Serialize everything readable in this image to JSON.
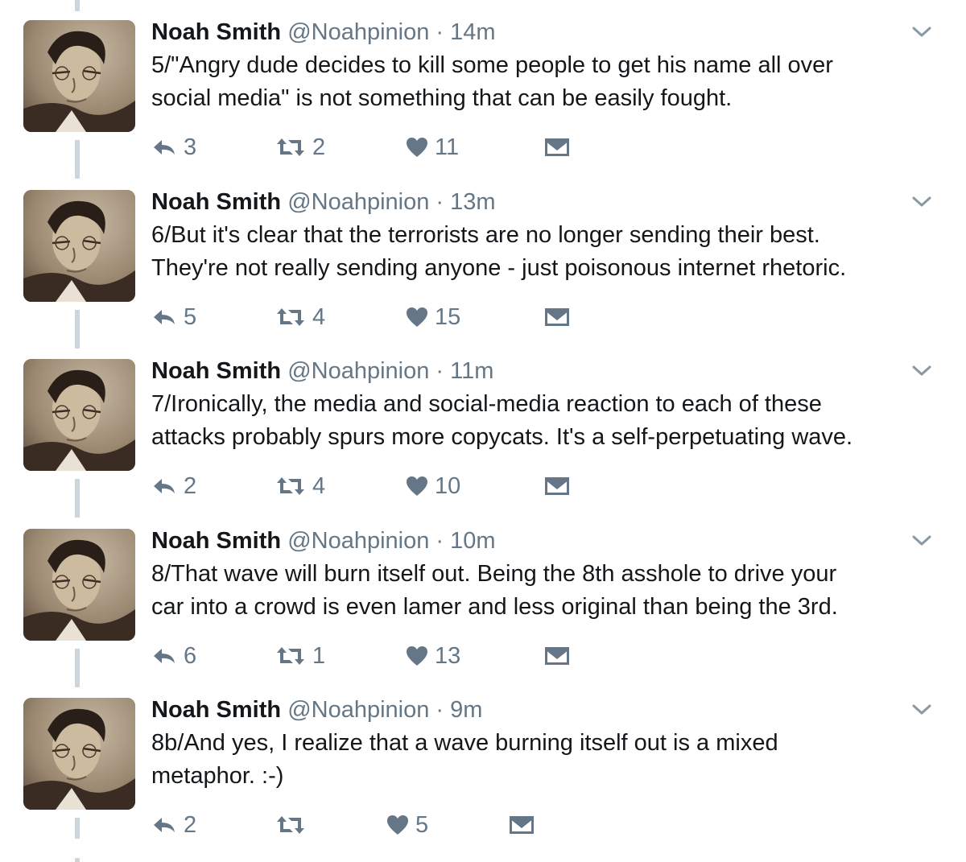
{
  "colors": {
    "name": "#14171a",
    "secondary": "#657786",
    "thread_line": "#ccd6dd"
  },
  "icons": {
    "reply": "reply-icon",
    "retweet": "retweet-icon",
    "like": "heart-icon",
    "dm": "envelope-icon",
    "more": "chevron-down-icon"
  },
  "tweets": [
    {
      "name": "Noah Smith",
      "handle": "@Noahpinion",
      "dot": "·",
      "time": "14m",
      "text": "5/\"Angry dude decides to kill some people to get his name all over\nsocial media\" is not something that can be easily fought.",
      "replies": "3",
      "retweets": "2",
      "likes": "11"
    },
    {
      "name": "Noah Smith",
      "handle": "@Noahpinion",
      "dot": "·",
      "time": "13m",
      "text": "6/But it's clear that the terrorists are no longer sending their best.\nThey're not really sending anyone - just poisonous internet rhetoric.",
      "replies": "5",
      "retweets": "4",
      "likes": "15"
    },
    {
      "name": "Noah Smith",
      "handle": "@Noahpinion",
      "dot": "·",
      "time": "11m",
      "text": "7/Ironically, the media and social-media reaction to each of these\nattacks probably spurs more copycats. It's a self-perpetuating wave.",
      "replies": "2",
      "retweets": "4",
      "likes": "10"
    },
    {
      "name": "Noah Smith",
      "handle": "@Noahpinion",
      "dot": "·",
      "time": "10m",
      "text": "8/That wave will burn itself out. Being the 8th asshole to drive your\ncar into a crowd is even lamer and less original than being the 3rd.",
      "replies": "6",
      "retweets": "1",
      "likes": "13"
    },
    {
      "name": "Noah Smith",
      "handle": "@Noahpinion",
      "dot": "·",
      "time": "9m",
      "text": "8b/And yes, I realize that a wave burning itself out is a mixed\nmetaphor. :-)",
      "replies": "2",
      "retweets": "",
      "likes": "5"
    }
  ]
}
